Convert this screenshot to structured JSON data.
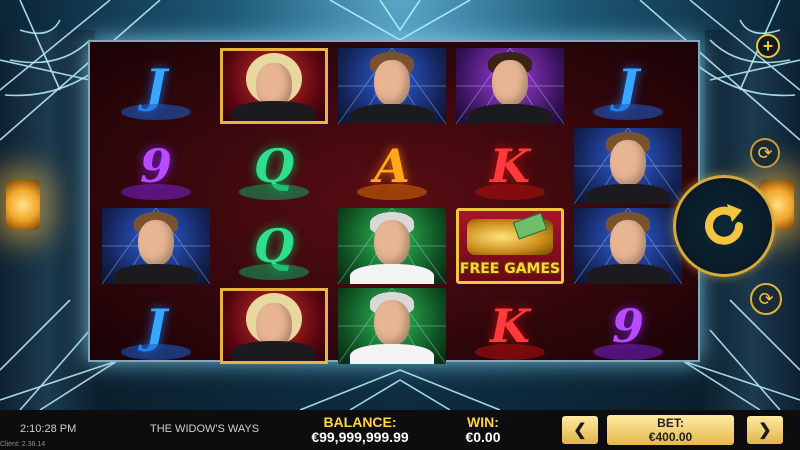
{
  "game": {
    "title": "THE WIDOW'S WAYS"
  },
  "status": {
    "clock": "2:10:28 PM",
    "client": "Client: 2.38.14"
  },
  "balance": {
    "label": "BALANCE:",
    "amount": "€99,999,999.99"
  },
  "win": {
    "label": "WIN:",
    "amount": "€0.00"
  },
  "bet": {
    "label": "BET:",
    "amount": "€400.00",
    "decrease": "❮",
    "increase": "❯"
  },
  "controls": {
    "plus": "+",
    "autoplay": "⟳",
    "turbo": "⟳"
  },
  "reels": [
    [
      "J",
      "widow",
      "blonde-man",
      "dark-man",
      "J"
    ],
    [
      "9",
      "Q",
      "A",
      "K",
      "blonde-man"
    ],
    [
      "blonde-man",
      "Q",
      "grey-man",
      "free-games",
      "blonde-man"
    ],
    [
      "J",
      "widow",
      "grey-man",
      "K",
      "9"
    ]
  ],
  "free_games_label": "FREE GAMES"
}
